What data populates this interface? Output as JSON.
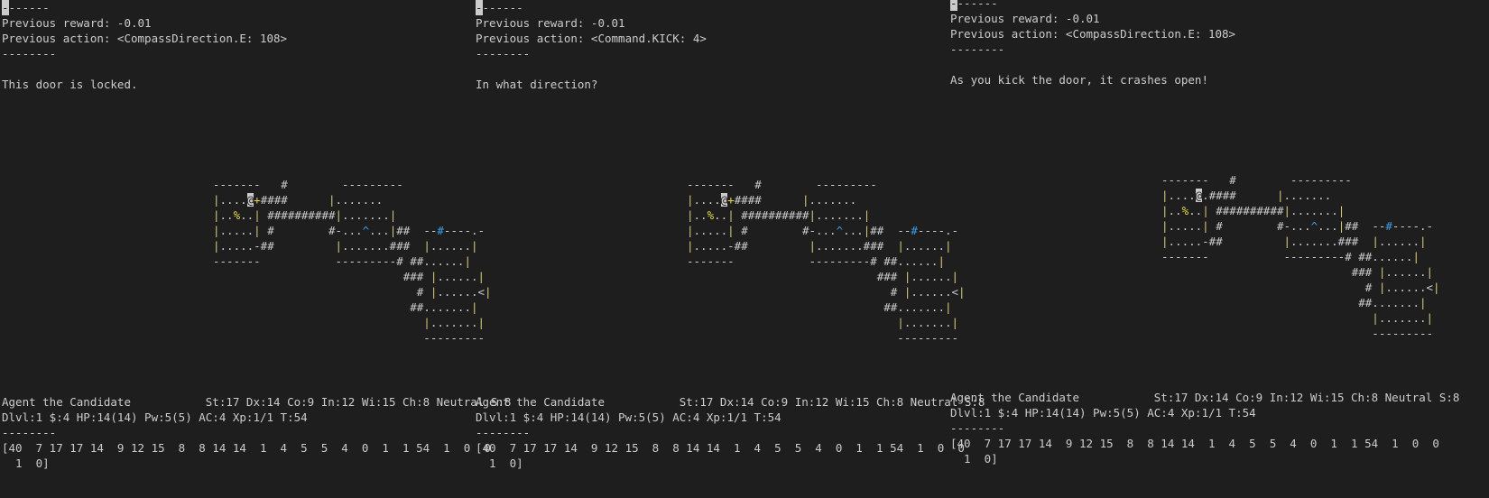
{
  "panels": [
    {
      "cursor_char": "-",
      "top_lines": [
        "-------",
        "Previous reward: -0.01",
        "Previous action: <CompassDirection.E: 108>",
        "--------",
        "",
        "This door is locked."
      ],
      "map_rows": [
        [
          {
            "t": "-------   #        ---------",
            "c": ""
          }
        ],
        [
          {
            "t": "|",
            "c": "c-wall"
          },
          {
            "t": "....",
            "c": ""
          },
          {
            "t": "@",
            "c": "c-player"
          },
          {
            "t": "+",
            "c": "c-food"
          },
          {
            "t": "####      ",
            "c": ""
          },
          {
            "t": "|",
            "c": "c-wall"
          },
          {
            "t": ".......",
            "c": ""
          }
        ],
        [
          {
            "t": "|",
            "c": "c-wall"
          },
          {
            "t": "..",
            "c": ""
          },
          {
            "t": "%",
            "c": "c-food"
          },
          {
            "t": "..",
            "c": ""
          },
          {
            "t": "|",
            "c": "c-wall"
          },
          {
            "t": " ##########",
            "c": ""
          },
          {
            "t": "|",
            "c": "c-wall"
          },
          {
            "t": ".......",
            "c": ""
          },
          {
            "t": "|",
            "c": "c-wall"
          }
        ],
        [
          {
            "t": "|",
            "c": "c-wall"
          },
          {
            "t": ".....",
            "c": ""
          },
          {
            "t": "|",
            "c": "c-wall"
          },
          {
            "t": " #        #-...",
            "c": ""
          },
          {
            "t": "^",
            "c": "c-trap"
          },
          {
            "t": "...",
            "c": ""
          },
          {
            "t": "|",
            "c": "c-wall"
          },
          {
            "t": "##  --",
            "c": ""
          },
          {
            "t": "#",
            "c": "c-door"
          },
          {
            "t": "----.-",
            "c": ""
          }
        ],
        [
          {
            "t": "|",
            "c": "c-wall"
          },
          {
            "t": ".....-##         ",
            "c": ""
          },
          {
            "t": "|",
            "c": "c-wall"
          },
          {
            "t": ".......###  ",
            "c": ""
          },
          {
            "t": "|",
            "c": "c-wall"
          },
          {
            "t": "......",
            "c": ""
          },
          {
            "t": "|",
            "c": "c-wall"
          }
        ],
        [
          {
            "t": "-------           ---------# ##",
            "c": ""
          },
          {
            "t": "......",
            "c": ""
          },
          {
            "t": "|",
            "c": "c-wall"
          }
        ],
        [
          {
            "t": "                            ### ",
            "c": ""
          },
          {
            "t": "|",
            "c": "c-wall"
          },
          {
            "t": "......",
            "c": ""
          },
          {
            "t": "|",
            "c": "c-wall"
          }
        ],
        [
          {
            "t": "                              # ",
            "c": ""
          },
          {
            "t": "|",
            "c": "c-wall"
          },
          {
            "t": "......<",
            "c": ""
          },
          {
            "t": "|",
            "c": "c-wall"
          }
        ],
        [
          {
            "t": "                             ##.......",
            "c": ""
          },
          {
            "t": "|",
            "c": "c-wall"
          }
        ],
        [
          {
            "t": "                               ",
            "c": ""
          },
          {
            "t": "|",
            "c": "c-wall"
          },
          {
            "t": ".......",
            "c": ""
          },
          {
            "t": "|",
            "c": "c-wall"
          }
        ],
        [
          {
            "t": "                               ---------",
            "c": ""
          }
        ]
      ],
      "status_line1": "Agent the Candidate           St:17 Dx:14 Co:9 In:12 Wi:15 Ch:8 Neutral S:8",
      "status_line2": "Dlvl:1 $:4 HP:14(14) Pw:5(5) AC:4 Xp:1/1 T:54",
      "separator": "--------",
      "obs_line1": "[40  7 17 17 14  9 12 15  8  8 14 14  1  4  5  5  4  0  1  1 54  1  0  0",
      "obs_line2": "  1  0]"
    },
    {
      "cursor_char": "-",
      "top_lines": [
        "-------",
        "Previous reward: -0.01",
        "Previous action: <Command.KICK: 4>",
        "--------",
        "",
        "In what direction?"
      ],
      "map_rows": [
        [
          {
            "t": "-------   #        ---------",
            "c": ""
          }
        ],
        [
          {
            "t": "|",
            "c": "c-wall"
          },
          {
            "t": "....",
            "c": ""
          },
          {
            "t": "@",
            "c": "c-player"
          },
          {
            "t": "+",
            "c": "c-food"
          },
          {
            "t": "####      ",
            "c": ""
          },
          {
            "t": "|",
            "c": "c-wall"
          },
          {
            "t": ".......",
            "c": ""
          }
        ],
        [
          {
            "t": "|",
            "c": "c-wall"
          },
          {
            "t": "..",
            "c": ""
          },
          {
            "t": "%",
            "c": "c-food"
          },
          {
            "t": "..",
            "c": ""
          },
          {
            "t": "|",
            "c": "c-wall"
          },
          {
            "t": " ##########",
            "c": ""
          },
          {
            "t": "|",
            "c": "c-wall"
          },
          {
            "t": ".......",
            "c": ""
          },
          {
            "t": "|",
            "c": "c-wall"
          }
        ],
        [
          {
            "t": "|",
            "c": "c-wall"
          },
          {
            "t": ".....",
            "c": ""
          },
          {
            "t": "|",
            "c": "c-wall"
          },
          {
            "t": " #        #-...",
            "c": ""
          },
          {
            "t": "^",
            "c": "c-trap"
          },
          {
            "t": "...",
            "c": ""
          },
          {
            "t": "|",
            "c": "c-wall"
          },
          {
            "t": "##  --",
            "c": ""
          },
          {
            "t": "#",
            "c": "c-door"
          },
          {
            "t": "----.-",
            "c": ""
          }
        ],
        [
          {
            "t": "|",
            "c": "c-wall"
          },
          {
            "t": ".....-##         ",
            "c": ""
          },
          {
            "t": "|",
            "c": "c-wall"
          },
          {
            "t": ".......###  ",
            "c": ""
          },
          {
            "t": "|",
            "c": "c-wall"
          },
          {
            "t": "......",
            "c": ""
          },
          {
            "t": "|",
            "c": "c-wall"
          }
        ],
        [
          {
            "t": "-------           ---------# ##",
            "c": ""
          },
          {
            "t": "......",
            "c": ""
          },
          {
            "t": "|",
            "c": "c-wall"
          }
        ],
        [
          {
            "t": "                            ### ",
            "c": ""
          },
          {
            "t": "|",
            "c": "c-wall"
          },
          {
            "t": "......",
            "c": ""
          },
          {
            "t": "|",
            "c": "c-wall"
          }
        ],
        [
          {
            "t": "                              # ",
            "c": ""
          },
          {
            "t": "|",
            "c": "c-wall"
          },
          {
            "t": "......<",
            "c": ""
          },
          {
            "t": "|",
            "c": "c-wall"
          }
        ],
        [
          {
            "t": "                             ##.......",
            "c": ""
          },
          {
            "t": "|",
            "c": "c-wall"
          }
        ],
        [
          {
            "t": "                               ",
            "c": ""
          },
          {
            "t": "|",
            "c": "c-wall"
          },
          {
            "t": ".......",
            "c": ""
          },
          {
            "t": "|",
            "c": "c-wall"
          }
        ],
        [
          {
            "t": "                               ---------",
            "c": ""
          }
        ]
      ],
      "status_line1": "Agent the Candidate           St:17 Dx:14 Co:9 In:12 Wi:15 Ch:8 Neutral S:8",
      "status_line2": "Dlvl:1 $:4 HP:14(14) Pw:5(5) AC:4 Xp:1/1 T:54",
      "separator": "--------",
      "obs_line1": "[40  7 17 17 14  9 12 15  8  8 14 14  1  4  5  5  4  0  1  1 54  1  0  0",
      "obs_line2": "  1  0]"
    },
    {
      "cursor_char": "-",
      "top_lines": [
        "-------",
        "Previous reward: -0.01",
        "Previous action: <CompassDirection.E: 108>",
        "--------",
        "",
        "As you kick the door, it crashes open!"
      ],
      "map_rows": [
        [
          {
            "t": "-------   #        ---------",
            "c": ""
          }
        ],
        [
          {
            "t": "|",
            "c": "c-wall"
          },
          {
            "t": "....",
            "c": ""
          },
          {
            "t": "@",
            "c": "c-player"
          },
          {
            "t": ".####      ",
            "c": ""
          },
          {
            "t": "|",
            "c": "c-wall"
          },
          {
            "t": ".......",
            "c": ""
          }
        ],
        [
          {
            "t": "|",
            "c": "c-wall"
          },
          {
            "t": "..",
            "c": ""
          },
          {
            "t": "%",
            "c": "c-food"
          },
          {
            "t": "..",
            "c": ""
          },
          {
            "t": "|",
            "c": "c-wall"
          },
          {
            "t": " ##########",
            "c": ""
          },
          {
            "t": "|",
            "c": "c-wall"
          },
          {
            "t": ".......",
            "c": ""
          },
          {
            "t": "|",
            "c": "c-wall"
          }
        ],
        [
          {
            "t": "|",
            "c": "c-wall"
          },
          {
            "t": ".....",
            "c": ""
          },
          {
            "t": "|",
            "c": "c-wall"
          },
          {
            "t": " #        #-...",
            "c": ""
          },
          {
            "t": "^",
            "c": "c-trap"
          },
          {
            "t": "...",
            "c": ""
          },
          {
            "t": "|",
            "c": "c-wall"
          },
          {
            "t": "##  --",
            "c": ""
          },
          {
            "t": "#",
            "c": "c-door"
          },
          {
            "t": "----.-",
            "c": ""
          }
        ],
        [
          {
            "t": "|",
            "c": "c-wall"
          },
          {
            "t": ".....-##         ",
            "c": ""
          },
          {
            "t": "|",
            "c": "c-wall"
          },
          {
            "t": ".......###  ",
            "c": ""
          },
          {
            "t": "|",
            "c": "c-wall"
          },
          {
            "t": "......",
            "c": ""
          },
          {
            "t": "|",
            "c": "c-wall"
          }
        ],
        [
          {
            "t": "-------           ---------# ##",
            "c": ""
          },
          {
            "t": "......",
            "c": ""
          },
          {
            "t": "|",
            "c": "c-wall"
          }
        ],
        [
          {
            "t": "                            ### ",
            "c": ""
          },
          {
            "t": "|",
            "c": "c-wall"
          },
          {
            "t": "......",
            "c": ""
          },
          {
            "t": "|",
            "c": "c-wall"
          }
        ],
        [
          {
            "t": "                              # ",
            "c": ""
          },
          {
            "t": "|",
            "c": "c-wall"
          },
          {
            "t": "......<",
            "c": ""
          },
          {
            "t": "|",
            "c": "c-wall"
          }
        ],
        [
          {
            "t": "                             ##.......",
            "c": ""
          },
          {
            "t": "|",
            "c": "c-wall"
          }
        ],
        [
          {
            "t": "                               ",
            "c": ""
          },
          {
            "t": "|",
            "c": "c-wall"
          },
          {
            "t": ".......",
            "c": ""
          },
          {
            "t": "|",
            "c": "c-wall"
          }
        ],
        [
          {
            "t": "                               ---------",
            "c": ""
          }
        ]
      ],
      "status_line1": "Agent the Candidate           St:17 Dx:14 Co:9 In:12 Wi:15 Ch:8 Neutral S:8",
      "status_line2": "Dlvl:1 $:4 HP:14(14) Pw:5(5) AC:4 Xp:1/1 T:54",
      "separator": "--------",
      "obs_line1": "[40  7 17 17 14  9 12 15  8  8 14 14  1  4  5  5  4  0  1  1 54  1  0  0",
      "obs_line2": "  1  0]"
    }
  ]
}
